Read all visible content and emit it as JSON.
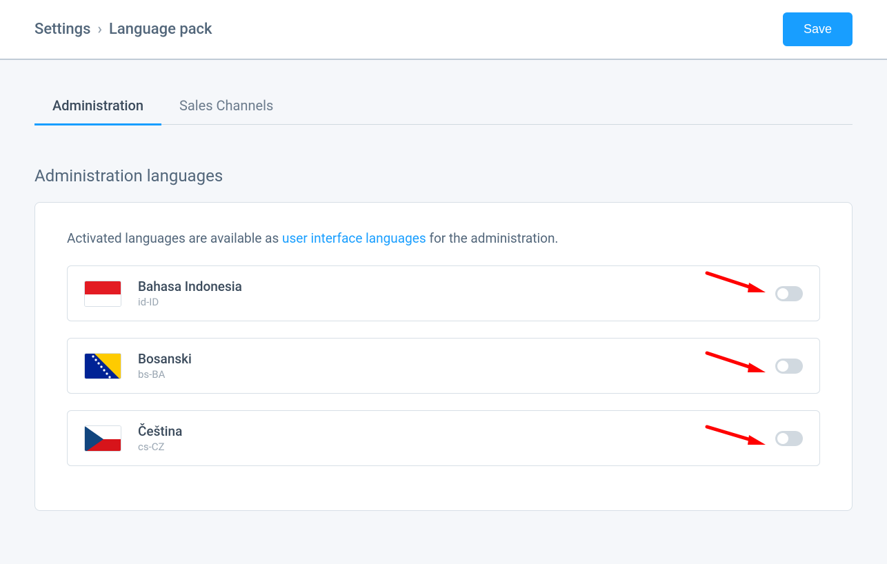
{
  "breadcrumb": {
    "root": "Settings",
    "current": "Language pack"
  },
  "actions": {
    "save_label": "Save"
  },
  "tabs": {
    "administration": "Administration",
    "sales_channels": "Sales Channels"
  },
  "section": {
    "title": "Administration languages",
    "desc_pre": "Activated languages are available as ",
    "desc_link": "user interface languages",
    "desc_post": " for the administration."
  },
  "languages": [
    {
      "name": "Bahasa Indonesia",
      "code": "id-ID",
      "flag": "indonesia",
      "enabled": false
    },
    {
      "name": "Bosanski",
      "code": "bs-BA",
      "flag": "bosnia",
      "enabled": false
    },
    {
      "name": "Čeština",
      "code": "cs-CZ",
      "flag": "czech",
      "enabled": false
    }
  ],
  "colors": {
    "primary": "#189eff",
    "text": "#52667a",
    "muted": "#9aa6b2",
    "border": "#d7dfe6",
    "annotation": "#ff0000"
  }
}
